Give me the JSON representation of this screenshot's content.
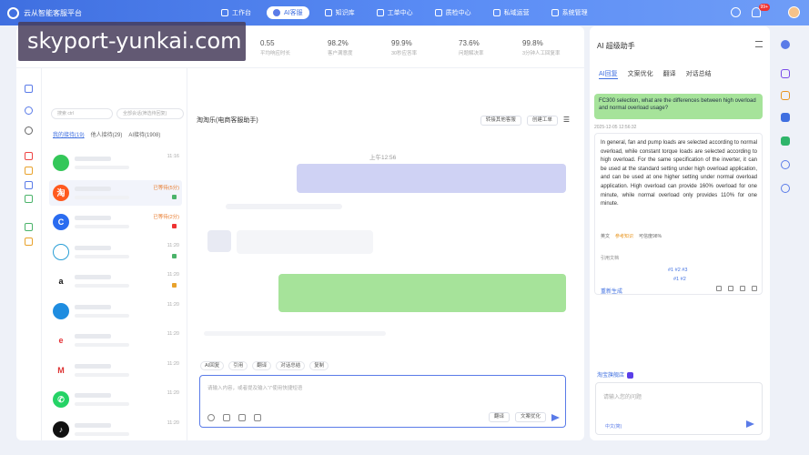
{
  "app": {
    "title": "云从智能客服平台"
  },
  "nav": [
    {
      "label": "工作台"
    },
    {
      "label": "AI客服",
      "active": true
    },
    {
      "label": "知识库"
    },
    {
      "label": "工单中心"
    },
    {
      "label": "质检中心"
    },
    {
      "label": "私域运营"
    },
    {
      "label": "系统管理"
    }
  ],
  "header": {
    "notif_count": "99+"
  },
  "watermark": "skyport-yunkai.com",
  "stats": [
    {
      "value": "0.55",
      "label": "平均响应时长"
    },
    {
      "value": "98.2%",
      "label": "客户满意度"
    },
    {
      "value": "99.9%",
      "label": "30秒应答率"
    },
    {
      "value": "73.6%",
      "label": "问题解决率"
    },
    {
      "value": "99.8%",
      "label": "3分钟人工回复率"
    }
  ],
  "list": {
    "search_placeholder": "搜索 ctrl",
    "search2_placeholder": "全部会话(筛选待回复)",
    "tabs": [
      "我的接待(19)",
      "他人接待(29)",
      "AI接待(1908)"
    ],
    "rows": [
      {
        "icon": "generic-green",
        "time": "11:16"
      },
      {
        "icon": "taobao",
        "time": "已等待(5分)",
        "alert": true
      },
      {
        "icon": "generic-blue",
        "time": "已等待(2分)",
        "alert": true
      },
      {
        "icon": "chat",
        "time": "11:20"
      },
      {
        "icon": "amazon",
        "time": "11:20"
      },
      {
        "icon": "edge",
        "time": "11:20"
      },
      {
        "icon": "ebay",
        "time": "11:20"
      },
      {
        "icon": "gmail",
        "time": "11:20"
      },
      {
        "icon": "whatsapp",
        "time": "11:20"
      },
      {
        "icon": "tiktok",
        "time": "11:20"
      },
      {
        "icon": "shopify",
        "time": "11:20"
      }
    ]
  },
  "chat": {
    "title": "淘淘乐(电商客服助手)",
    "btn_transfer": "转接其他客服",
    "btn_ticket": "创建工单",
    "timestamp": "上午12:56",
    "quick": [
      "AI回复",
      "引用",
      "翻译",
      "对话总结",
      "复制"
    ],
    "input_placeholder": "请输入内容，或者提及输入“/”使用快捷短语",
    "btn_translate": "翻译",
    "btn_polish": "文案优化"
  },
  "ai": {
    "title": "AI 超级助手",
    "tabs": [
      "AI回复",
      "文案优化",
      "翻译",
      "对话总结"
    ],
    "question": "FC300 selection, what are the differences between high overload and normal overload usage?",
    "qtime": "2025-12-05 12:56:32",
    "answer": "In general, fan and pump loads are selected according to normal overload, while constant torque loads are selected according to high overload. For the same specification of the inverter, it can be used at the standard setting under high overload application, and can be used at one higher setting under normal overload application. High overload can provide 160% overload for one minute, while normal overload only provides 110% for one minute.",
    "tags": [
      "英文",
      "参考知识",
      "可信度98%"
    ],
    "source_label": "引用文档",
    "refs": [
      "#1  #2  #3",
      "#1  #2"
    ],
    "regen": "重新生成",
    "shop": "淘宝旗舰店",
    "input_placeholder": "请输入您的问题",
    "kb": "中文(简)"
  },
  "colors": {
    "accent": "#3f6fe0",
    "bubble_user": "#a6e39a",
    "bubble_agent": "#cfd2f4"
  }
}
